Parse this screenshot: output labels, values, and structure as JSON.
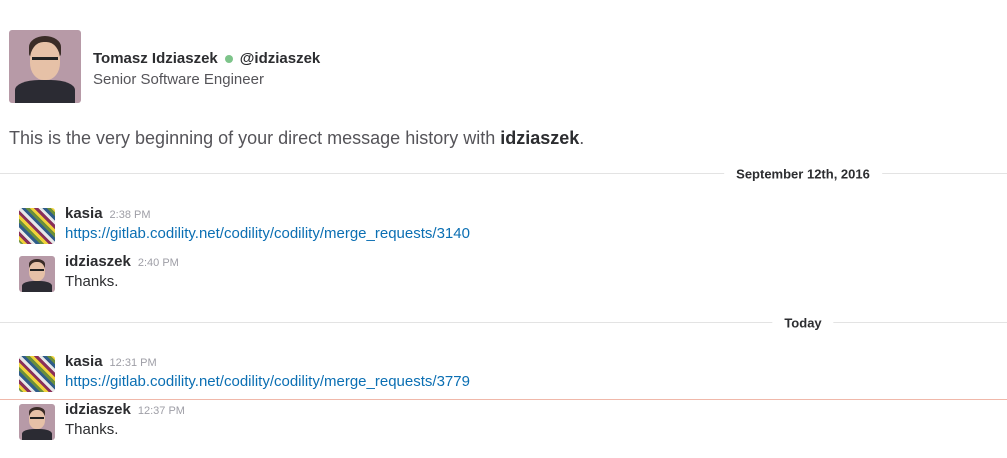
{
  "profile": {
    "name": "Tomasz Idziaszek",
    "handle": "@idziaszek",
    "title": "Senior Software Engineer",
    "presence_color": "#7dc48a"
  },
  "intro": {
    "prefix": "This is the very beginning of your direct message history with ",
    "user": "idziaszek",
    "suffix": "."
  },
  "dividers": [
    {
      "label": "September 12th, 2016"
    },
    {
      "label": "Today"
    }
  ],
  "messages": [
    {
      "sender": "kasia",
      "time": "2:38 PM",
      "text": "https://gitlab.codility.net/codility/codility/merge_requests/3140",
      "is_link": true
    },
    {
      "sender": "idziaszek",
      "time": "2:40 PM",
      "text": "Thanks.",
      "is_link": false
    },
    {
      "sender": "kasia",
      "time": "12:31 PM",
      "text": "https://gitlab.codility.net/codility/codility/merge_requests/3779",
      "is_link": true
    },
    {
      "sender": "idziaszek",
      "time": "12:37 PM",
      "text": "Thanks.",
      "is_link": false
    }
  ],
  "colors": {
    "link": "#0b6fb3",
    "new_messages_line": "#f0b8aa"
  }
}
